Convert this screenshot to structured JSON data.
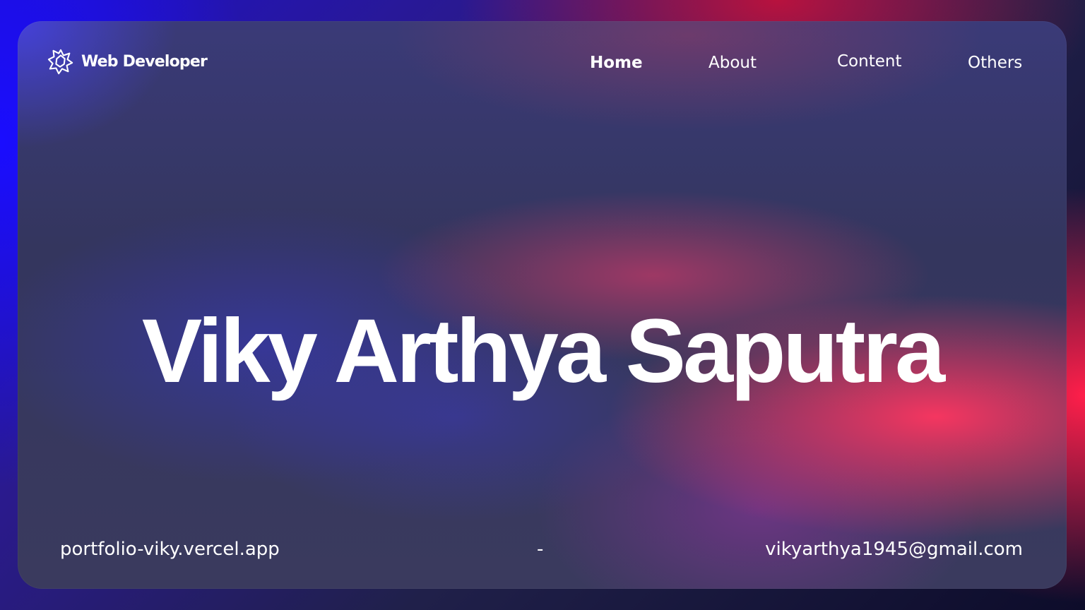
{
  "header": {
    "brand_name": "Web Developer",
    "brand_icon": "star-burst-icon",
    "nav": [
      {
        "label": "Home",
        "active": true
      },
      {
        "label": "About",
        "active": false
      },
      {
        "label": "Content",
        "active": false
      },
      {
        "label": "Others",
        "active": false
      }
    ]
  },
  "hero": {
    "title": "Viky Arthya Saputra"
  },
  "footer": {
    "website": "portfolio-viky.vercel.app",
    "separator": "-",
    "email": "vikyarthya1945@gmail.com"
  },
  "colors": {
    "text": "#ffffff",
    "accent_blue": "#1a0dff",
    "accent_red": "#ff1f4a"
  }
}
